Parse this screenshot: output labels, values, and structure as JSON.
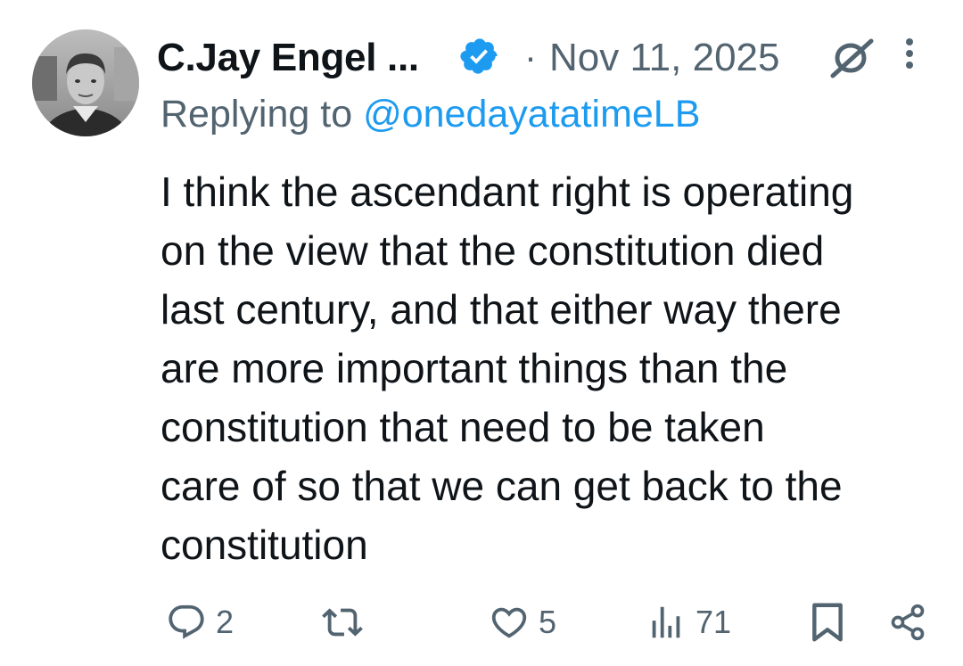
{
  "author": {
    "display_name": "C.Jay Engel ...",
    "verified": true,
    "verified_color": "#1d9bf0",
    "avatar_icon": "profile-photo"
  },
  "meta": {
    "separator": "·",
    "date": "Nov 11, 2025"
  },
  "reply": {
    "prefix": "Replying to ",
    "handle": "@onedayatatimeLB"
  },
  "tweet": {
    "lines": [
      "I think the ascendant right is operating",
      "on the view that the constitution died",
      "last century, and that either way there",
      "are more important things than the",
      "constitution that need to be taken",
      "care of so that we can get back to the",
      "constitution"
    ]
  },
  "actions": {
    "replies": "2",
    "reposts": "",
    "likes": "5",
    "views": "71"
  },
  "colors": {
    "text": "#0f1419",
    "secondary": "#536471",
    "accent": "#1d9bf0"
  }
}
